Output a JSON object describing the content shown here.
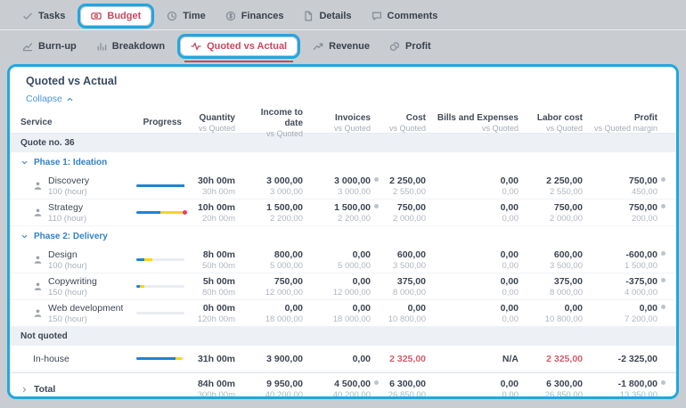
{
  "header_tabs": [
    {
      "label": "Tasks",
      "icon": "check-icon",
      "selected": false,
      "highlighted": false
    },
    {
      "label": "Budget",
      "icon": "banknote-icon",
      "selected": true,
      "highlighted": true
    },
    {
      "label": "Time",
      "icon": "clock-icon",
      "selected": false,
      "highlighted": false
    },
    {
      "label": "Finances",
      "icon": "finances-icon",
      "selected": false,
      "highlighted": false
    },
    {
      "label": "Details",
      "icon": "document-icon",
      "selected": false,
      "highlighted": false
    },
    {
      "label": "Comments",
      "icon": "comment-icon",
      "selected": false,
      "highlighted": false
    }
  ],
  "sub_tabs": [
    {
      "label": "Burn-up",
      "icon": "burnup-icon",
      "selected": false,
      "highlighted": false
    },
    {
      "label": "Breakdown",
      "icon": "barchart-icon",
      "selected": false,
      "highlighted": false
    },
    {
      "label": "Quoted vs Actual",
      "icon": "pulse-icon",
      "selected": true,
      "highlighted": true
    },
    {
      "label": "Revenue",
      "icon": "trend-icon",
      "selected": false,
      "highlighted": false
    },
    {
      "label": "Profit",
      "icon": "coins-icon",
      "selected": false,
      "highlighted": false
    }
  ],
  "panel": {
    "title": "Quoted vs Actual",
    "collapse_label": "Collapse",
    "columns": [
      {
        "label": "Service",
        "sub": "",
        "align": "left"
      },
      {
        "label": "Progress",
        "sub": "",
        "align": "right"
      },
      {
        "label": "Quantity",
        "sub": "vs Quoted",
        "align": "right"
      },
      {
        "label": "Income to date",
        "sub": "vs Quoted",
        "align": "right"
      },
      {
        "label": "Invoices",
        "sub": "vs Quoted",
        "align": "right"
      },
      {
        "label": "Cost",
        "sub": "vs Quoted",
        "align": "right"
      },
      {
        "label": "Bills and Expenses",
        "sub": "vs Quoted",
        "align": "right"
      },
      {
        "label": "Labor cost",
        "sub": "vs Quoted",
        "align": "right"
      },
      {
        "label": "Profit",
        "sub": "vs Quoted margin",
        "align": "right"
      }
    ],
    "rows": [
      {
        "type": "section",
        "label": "Quote no. 36"
      },
      {
        "type": "phase",
        "label": "Phase 1: Ideation"
      },
      {
        "type": "service",
        "name": "Discovery",
        "detail": "100 (hour)",
        "progress": {
          "segments": [
            {
              "color": "blue",
              "pct": 100
            }
          ],
          "end_dot": false
        },
        "cells": [
          {
            "main": "30h 00m",
            "sub": "30h 00m",
            "dot": false,
            "red": false
          },
          {
            "main": "3 000,00",
            "sub": "3 000,00",
            "dot": false,
            "red": false
          },
          {
            "main": "3 000,00",
            "sub": "3 000,00",
            "dot": true,
            "red": false
          },
          {
            "main": "2 250,00",
            "sub": "2 550,00",
            "dot": false,
            "red": false
          },
          {
            "main": "0,00",
            "sub": "0,00",
            "dot": false,
            "red": false
          },
          {
            "main": "2 250,00",
            "sub": "2 550,00",
            "dot": false,
            "red": false
          },
          {
            "main": "750,00",
            "sub": "450,00",
            "dot": true,
            "red": false
          }
        ]
      },
      {
        "type": "service",
        "name": "Strategy",
        "detail": "110 (hour)",
        "progress": {
          "segments": [
            {
              "color": "blue",
              "pct": 50
            },
            {
              "color": "yellow",
              "pct": 48
            }
          ],
          "end_dot": true
        },
        "cells": [
          {
            "main": "10h 00m",
            "sub": "20h 00m",
            "dot": false,
            "red": false
          },
          {
            "main": "1 500,00",
            "sub": "2 200,00",
            "dot": false,
            "red": false
          },
          {
            "main": "1 500,00",
            "sub": "2 200,00",
            "dot": true,
            "red": false
          },
          {
            "main": "750,00",
            "sub": "2 000,00",
            "dot": false,
            "red": false
          },
          {
            "main": "0,00",
            "sub": "0,00",
            "dot": false,
            "red": false
          },
          {
            "main": "750,00",
            "sub": "2 000,00",
            "dot": false,
            "red": false
          },
          {
            "main": "750,00",
            "sub": "200,00",
            "dot": true,
            "red": false
          }
        ]
      },
      {
        "type": "phase",
        "label": "Phase 2: Delivery"
      },
      {
        "type": "service",
        "name": "Design",
        "detail": "100 (hour)",
        "progress": {
          "segments": [
            {
              "color": "blue",
              "pct": 17
            },
            {
              "color": "yellow",
              "pct": 17
            }
          ],
          "end_dot": false
        },
        "cells": [
          {
            "main": "8h 00m",
            "sub": "50h 00m",
            "dot": false,
            "red": false
          },
          {
            "main": "800,00",
            "sub": "5 000,00",
            "dot": false,
            "red": false
          },
          {
            "main": "0,00",
            "sub": "5 000,00",
            "dot": false,
            "red": false
          },
          {
            "main": "600,00",
            "sub": "3 500,00",
            "dot": false,
            "red": false
          },
          {
            "main": "0,00",
            "sub": "0,00",
            "dot": false,
            "red": false
          },
          {
            "main": "600,00",
            "sub": "3 500,00",
            "dot": false,
            "red": false
          },
          {
            "main": "-600,00",
            "sub": "1 500,00",
            "dot": true,
            "red": false
          }
        ]
      },
      {
        "type": "service",
        "name": "Copywriting",
        "detail": "150 (hour)",
        "progress": {
          "segments": [
            {
              "color": "blue",
              "pct": 7
            },
            {
              "color": "yellow",
              "pct": 9
            }
          ],
          "end_dot": false
        },
        "cells": [
          {
            "main": "5h 00m",
            "sub": "80h 00m",
            "dot": false,
            "red": false
          },
          {
            "main": "750,00",
            "sub": "12 000,00",
            "dot": false,
            "red": false
          },
          {
            "main": "0,00",
            "sub": "12 000,00",
            "dot": false,
            "red": false
          },
          {
            "main": "375,00",
            "sub": "8 000,00",
            "dot": false,
            "red": false
          },
          {
            "main": "0,00",
            "sub": "0,00",
            "dot": false,
            "red": false
          },
          {
            "main": "375,00",
            "sub": "8 000,00",
            "dot": false,
            "red": false
          },
          {
            "main": "-375,00",
            "sub": "4 000,00",
            "dot": true,
            "red": false
          }
        ]
      },
      {
        "type": "service",
        "name": "Web development",
        "detail": "150 (hour)",
        "progress": {
          "segments": [],
          "end_dot": false
        },
        "cells": [
          {
            "main": "0h 00m",
            "sub": "120h 00m",
            "dot": false,
            "red": false
          },
          {
            "main": "0,00",
            "sub": "18 000,00",
            "dot": false,
            "red": false
          },
          {
            "main": "0,00",
            "sub": "18 000,00",
            "dot": false,
            "red": false
          },
          {
            "main": "0,00",
            "sub": "10 800,00",
            "dot": false,
            "red": false
          },
          {
            "main": "0,00",
            "sub": "0,00",
            "dot": false,
            "red": false
          },
          {
            "main": "0,00",
            "sub": "10 800,00",
            "dot": false,
            "red": false
          },
          {
            "main": "0,00",
            "sub": "7 200,00",
            "dot": true,
            "red": false
          }
        ]
      },
      {
        "type": "section",
        "label": "Not quoted"
      },
      {
        "type": "service",
        "name": "In-house",
        "detail": "",
        "no_icon": true,
        "progress": {
          "segments": [
            {
              "color": "blue",
              "pct": 82
            },
            {
              "color": "yellow",
              "pct": 13
            }
          ],
          "end_dot": false
        },
        "cells": [
          {
            "main": "31h 00m",
            "sub": "",
            "dot": false,
            "red": false
          },
          {
            "main": "3 900,00",
            "sub": "",
            "dot": false,
            "red": false
          },
          {
            "main": "0,00",
            "sub": "",
            "dot": false,
            "red": false
          },
          {
            "main": "2 325,00",
            "sub": "",
            "dot": false,
            "red": true
          },
          {
            "main": "N/A",
            "sub": "",
            "dot": false,
            "red": false
          },
          {
            "main": "2 325,00",
            "sub": "",
            "dot": false,
            "red": true
          },
          {
            "main": "-2 325,00",
            "sub": "",
            "dot": false,
            "red": false
          }
        ]
      },
      {
        "type": "total",
        "name": "Total",
        "cells": [
          {
            "main": "84h 00m",
            "sub": "300h 00m",
            "dot": false,
            "red": false
          },
          {
            "main": "9 950,00",
            "sub": "40 200,00",
            "dot": false,
            "red": false
          },
          {
            "main": "4 500,00",
            "sub": "40 200,00",
            "dot": true,
            "red": false
          },
          {
            "main": "6 300,00",
            "sub": "26 850,00",
            "dot": false,
            "red": false
          },
          {
            "main": "0,00",
            "sub": "0,00",
            "dot": false,
            "red": false
          },
          {
            "main": "6 300,00",
            "sub": "26 850,00",
            "dot": false,
            "red": false
          },
          {
            "main": "-1 800,00",
            "sub": "13 350,00",
            "dot": true,
            "red": false
          }
        ]
      }
    ]
  },
  "icon_names": {
    "service_row": "person-icon",
    "phase": "chevron-down-icon",
    "collapse": "chevron-up-icon",
    "total": "chevron-right-icon",
    "info": "info-dot"
  },
  "colors": {
    "annotation_cyan": "#21a7e0",
    "selected_tab_red": "#c8485e",
    "progress_blue": "#1f83d3",
    "progress_yellow": "#ffd21e",
    "over_budget_dot": "#ef3e68",
    "negative_value_red": "#d05f6b",
    "phase_blue": "#3282c4",
    "link_blue": "#4a94d8",
    "section_bg": "#edf1f6",
    "background_gray": "#c9ccd1"
  }
}
